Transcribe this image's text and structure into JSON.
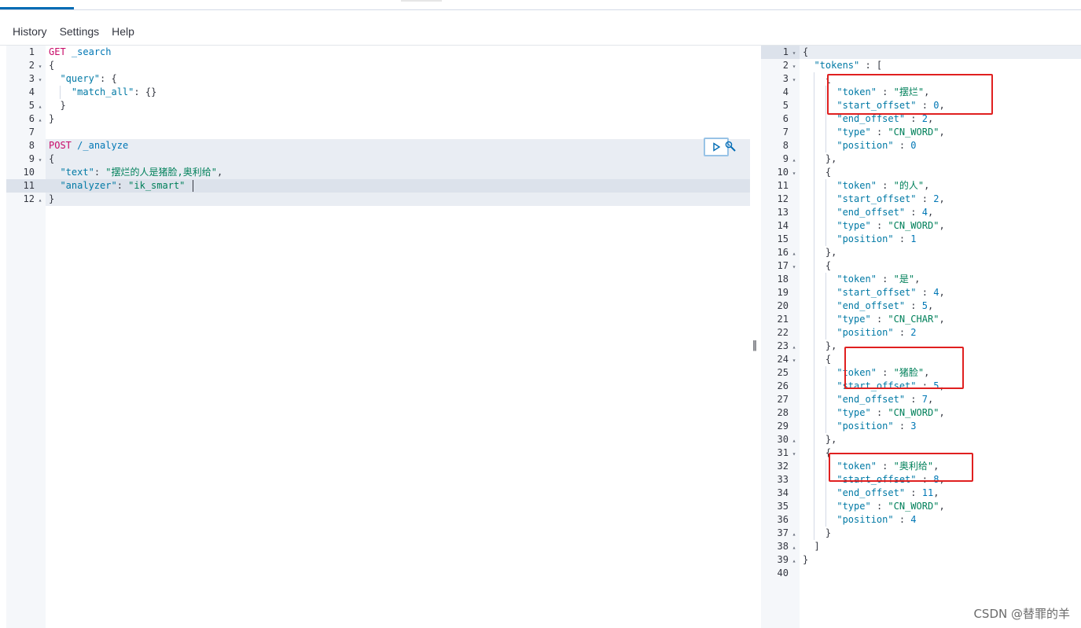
{
  "menu": [
    "History",
    "Settings",
    "Help"
  ],
  "left_lines": [
    {
      "n": "1",
      "fold": "",
      "tokens": [
        [
          "k-method",
          "GET"
        ],
        [
          "k-punc",
          " "
        ],
        [
          "k-url",
          "_search"
        ]
      ]
    },
    {
      "n": "2",
      "fold": "▾",
      "tokens": [
        [
          "k-punc",
          "{"
        ]
      ]
    },
    {
      "n": "3",
      "fold": "▾",
      "tokens": [
        [
          "k-punc",
          "  "
        ],
        [
          "k-prop",
          "\"query\""
        ],
        [
          "k-punc",
          ": {"
        ]
      ]
    },
    {
      "n": "4",
      "fold": "",
      "tokens": [
        [
          "k-punc",
          "    "
        ],
        [
          "k-prop",
          "\"match_all\""
        ],
        [
          "k-punc",
          ": {}"
        ]
      ]
    },
    {
      "n": "5",
      "fold": "▴",
      "tokens": [
        [
          "k-punc",
          "  }"
        ]
      ]
    },
    {
      "n": "6",
      "fold": "▴",
      "tokens": [
        [
          "k-punc",
          "}"
        ]
      ]
    },
    {
      "n": "7",
      "fold": "",
      "tokens": []
    },
    {
      "n": "8",
      "fold": "",
      "tokens": [
        [
          "k-method",
          "POST"
        ],
        [
          "k-punc",
          " "
        ],
        [
          "k-url",
          "/_analyze"
        ]
      ]
    },
    {
      "n": "9",
      "fold": "▾",
      "tokens": [
        [
          "k-punc",
          "{"
        ]
      ]
    },
    {
      "n": "10",
      "fold": "",
      "tokens": [
        [
          "k-punc",
          "  "
        ],
        [
          "k-prop",
          "\"text\""
        ],
        [
          "k-punc",
          ": "
        ],
        [
          "k-str",
          "\"摆烂的人是猪脸,奥利给\""
        ],
        [
          "k-punc",
          ","
        ]
      ]
    },
    {
      "n": "11",
      "fold": "",
      "tokens": [
        [
          "k-punc",
          "  "
        ],
        [
          "k-prop",
          "\"analyzer\""
        ],
        [
          "k-punc",
          ": "
        ],
        [
          "k-str",
          "\"ik_smart\""
        ]
      ]
    },
    {
      "n": "12",
      "fold": "▴",
      "tokens": [
        [
          "k-punc",
          "}"
        ]
      ]
    }
  ],
  "right_lines": [
    {
      "n": "1",
      "fold": "▾",
      "tokens": [
        [
          "k-punc",
          "{"
        ]
      ]
    },
    {
      "n": "2",
      "fold": "▾",
      "tokens": [
        [
          "k-punc",
          "  "
        ],
        [
          "k-prop",
          "\"tokens\""
        ],
        [
          "k-punc",
          " : ["
        ]
      ]
    },
    {
      "n": "3",
      "fold": "▾",
      "tokens": [
        [
          "k-punc",
          "    {"
        ]
      ]
    },
    {
      "n": "4",
      "fold": "",
      "tokens": [
        [
          "k-punc",
          "      "
        ],
        [
          "k-prop",
          "\"token\""
        ],
        [
          "k-punc",
          " : "
        ],
        [
          "k-str",
          "\"摆烂\""
        ],
        [
          "k-punc",
          ","
        ]
      ]
    },
    {
      "n": "5",
      "fold": "",
      "tokens": [
        [
          "k-punc",
          "      "
        ],
        [
          "k-prop",
          "\"start_offset\""
        ],
        [
          "k-punc",
          " : "
        ],
        [
          "k-num",
          "0"
        ],
        [
          "k-punc",
          ","
        ]
      ]
    },
    {
      "n": "6",
      "fold": "",
      "tokens": [
        [
          "k-punc",
          "      "
        ],
        [
          "k-prop",
          "\"end_offset\""
        ],
        [
          "k-punc",
          " : "
        ],
        [
          "k-num",
          "2"
        ],
        [
          "k-punc",
          ","
        ]
      ]
    },
    {
      "n": "7",
      "fold": "",
      "tokens": [
        [
          "k-punc",
          "      "
        ],
        [
          "k-prop",
          "\"type\""
        ],
        [
          "k-punc",
          " : "
        ],
        [
          "k-str",
          "\"CN_WORD\""
        ],
        [
          "k-punc",
          ","
        ]
      ]
    },
    {
      "n": "8",
      "fold": "",
      "tokens": [
        [
          "k-punc",
          "      "
        ],
        [
          "k-prop",
          "\"position\""
        ],
        [
          "k-punc",
          " : "
        ],
        [
          "k-num",
          "0"
        ]
      ]
    },
    {
      "n": "9",
      "fold": "▴",
      "tokens": [
        [
          "k-punc",
          "    },"
        ]
      ]
    },
    {
      "n": "10",
      "fold": "▾",
      "tokens": [
        [
          "k-punc",
          "    {"
        ]
      ]
    },
    {
      "n": "11",
      "fold": "",
      "tokens": [
        [
          "k-punc",
          "      "
        ],
        [
          "k-prop",
          "\"token\""
        ],
        [
          "k-punc",
          " : "
        ],
        [
          "k-str",
          "\"的人\""
        ],
        [
          "k-punc",
          ","
        ]
      ]
    },
    {
      "n": "12",
      "fold": "",
      "tokens": [
        [
          "k-punc",
          "      "
        ],
        [
          "k-prop",
          "\"start_offset\""
        ],
        [
          "k-punc",
          " : "
        ],
        [
          "k-num",
          "2"
        ],
        [
          "k-punc",
          ","
        ]
      ]
    },
    {
      "n": "13",
      "fold": "",
      "tokens": [
        [
          "k-punc",
          "      "
        ],
        [
          "k-prop",
          "\"end_offset\""
        ],
        [
          "k-punc",
          " : "
        ],
        [
          "k-num",
          "4"
        ],
        [
          "k-punc",
          ","
        ]
      ]
    },
    {
      "n": "14",
      "fold": "",
      "tokens": [
        [
          "k-punc",
          "      "
        ],
        [
          "k-prop",
          "\"type\""
        ],
        [
          "k-punc",
          " : "
        ],
        [
          "k-str",
          "\"CN_WORD\""
        ],
        [
          "k-punc",
          ","
        ]
      ]
    },
    {
      "n": "15",
      "fold": "",
      "tokens": [
        [
          "k-punc",
          "      "
        ],
        [
          "k-prop",
          "\"position\""
        ],
        [
          "k-punc",
          " : "
        ],
        [
          "k-num",
          "1"
        ]
      ]
    },
    {
      "n": "16",
      "fold": "▴",
      "tokens": [
        [
          "k-punc",
          "    },"
        ]
      ]
    },
    {
      "n": "17",
      "fold": "▾",
      "tokens": [
        [
          "k-punc",
          "    {"
        ]
      ]
    },
    {
      "n": "18",
      "fold": "",
      "tokens": [
        [
          "k-punc",
          "      "
        ],
        [
          "k-prop",
          "\"token\""
        ],
        [
          "k-punc",
          " : "
        ],
        [
          "k-str",
          "\"是\""
        ],
        [
          "k-punc",
          ","
        ]
      ]
    },
    {
      "n": "19",
      "fold": "",
      "tokens": [
        [
          "k-punc",
          "      "
        ],
        [
          "k-prop",
          "\"start_offset\""
        ],
        [
          "k-punc",
          " : "
        ],
        [
          "k-num",
          "4"
        ],
        [
          "k-punc",
          ","
        ]
      ]
    },
    {
      "n": "20",
      "fold": "",
      "tokens": [
        [
          "k-punc",
          "      "
        ],
        [
          "k-prop",
          "\"end_offset\""
        ],
        [
          "k-punc",
          " : "
        ],
        [
          "k-num",
          "5"
        ],
        [
          "k-punc",
          ","
        ]
      ]
    },
    {
      "n": "21",
      "fold": "",
      "tokens": [
        [
          "k-punc",
          "      "
        ],
        [
          "k-prop",
          "\"type\""
        ],
        [
          "k-punc",
          " : "
        ],
        [
          "k-str",
          "\"CN_CHAR\""
        ],
        [
          "k-punc",
          ","
        ]
      ]
    },
    {
      "n": "22",
      "fold": "",
      "tokens": [
        [
          "k-punc",
          "      "
        ],
        [
          "k-prop",
          "\"position\""
        ],
        [
          "k-punc",
          " : "
        ],
        [
          "k-num",
          "2"
        ]
      ]
    },
    {
      "n": "23",
      "fold": "▴",
      "tokens": [
        [
          "k-punc",
          "    },"
        ]
      ]
    },
    {
      "n": "24",
      "fold": "▾",
      "tokens": [
        [
          "k-punc",
          "    {"
        ]
      ]
    },
    {
      "n": "25",
      "fold": "",
      "tokens": [
        [
          "k-punc",
          "      "
        ],
        [
          "k-prop",
          "\"token\""
        ],
        [
          "k-punc",
          " : "
        ],
        [
          "k-str",
          "\"猪脸\""
        ],
        [
          "k-punc",
          ","
        ]
      ]
    },
    {
      "n": "26",
      "fold": "",
      "tokens": [
        [
          "k-punc",
          "      "
        ],
        [
          "k-prop",
          "\"start_offset\""
        ],
        [
          "k-punc",
          " : "
        ],
        [
          "k-num",
          "5"
        ],
        [
          "k-punc",
          ","
        ]
      ]
    },
    {
      "n": "27",
      "fold": "",
      "tokens": [
        [
          "k-punc",
          "      "
        ],
        [
          "k-prop",
          "\"end_offset\""
        ],
        [
          "k-punc",
          " : "
        ],
        [
          "k-num",
          "7"
        ],
        [
          "k-punc",
          ","
        ]
      ]
    },
    {
      "n": "28",
      "fold": "",
      "tokens": [
        [
          "k-punc",
          "      "
        ],
        [
          "k-prop",
          "\"type\""
        ],
        [
          "k-punc",
          " : "
        ],
        [
          "k-str",
          "\"CN_WORD\""
        ],
        [
          "k-punc",
          ","
        ]
      ]
    },
    {
      "n": "29",
      "fold": "",
      "tokens": [
        [
          "k-punc",
          "      "
        ],
        [
          "k-prop",
          "\"position\""
        ],
        [
          "k-punc",
          " : "
        ],
        [
          "k-num",
          "3"
        ]
      ]
    },
    {
      "n": "30",
      "fold": "▴",
      "tokens": [
        [
          "k-punc",
          "    },"
        ]
      ]
    },
    {
      "n": "31",
      "fold": "▾",
      "tokens": [
        [
          "k-punc",
          "    {"
        ]
      ]
    },
    {
      "n": "32",
      "fold": "",
      "tokens": [
        [
          "k-punc",
          "      "
        ],
        [
          "k-prop",
          "\"token\""
        ],
        [
          "k-punc",
          " : "
        ],
        [
          "k-str",
          "\"奥利给\""
        ],
        [
          "k-punc",
          ","
        ]
      ]
    },
    {
      "n": "33",
      "fold": "",
      "tokens": [
        [
          "k-punc",
          "      "
        ],
        [
          "k-prop",
          "\"start_offset\""
        ],
        [
          "k-punc",
          " : "
        ],
        [
          "k-num",
          "8"
        ],
        [
          "k-punc",
          ","
        ]
      ]
    },
    {
      "n": "34",
      "fold": "",
      "tokens": [
        [
          "k-punc",
          "      "
        ],
        [
          "k-prop",
          "\"end_offset\""
        ],
        [
          "k-punc",
          " : "
        ],
        [
          "k-num",
          "11"
        ],
        [
          "k-punc",
          ","
        ]
      ]
    },
    {
      "n": "35",
      "fold": "",
      "tokens": [
        [
          "k-punc",
          "      "
        ],
        [
          "k-prop",
          "\"type\""
        ],
        [
          "k-punc",
          " : "
        ],
        [
          "k-str",
          "\"CN_WORD\""
        ],
        [
          "k-punc",
          ","
        ]
      ]
    },
    {
      "n": "36",
      "fold": "",
      "tokens": [
        [
          "k-punc",
          "      "
        ],
        [
          "k-prop",
          "\"position\""
        ],
        [
          "k-punc",
          " : "
        ],
        [
          "k-num",
          "4"
        ]
      ]
    },
    {
      "n": "37",
      "fold": "▴",
      "tokens": [
        [
          "k-punc",
          "    }"
        ]
      ]
    },
    {
      "n": "38",
      "fold": "▴",
      "tokens": [
        [
          "k-punc",
          "  ]"
        ]
      ]
    },
    {
      "n": "39",
      "fold": "▴",
      "tokens": [
        [
          "k-punc",
          "}"
        ]
      ]
    },
    {
      "n": "40",
      "fold": "",
      "tokens": []
    }
  ],
  "divider_glyph": "‖",
  "watermark": "CSDN @替罪的羊",
  "icons": {
    "run": "play-icon",
    "settings": "wrench-icon"
  },
  "colors": {
    "method": "#c80a68",
    "property": "#0079a5",
    "string": "#00805a",
    "highlight": "#e02020"
  }
}
